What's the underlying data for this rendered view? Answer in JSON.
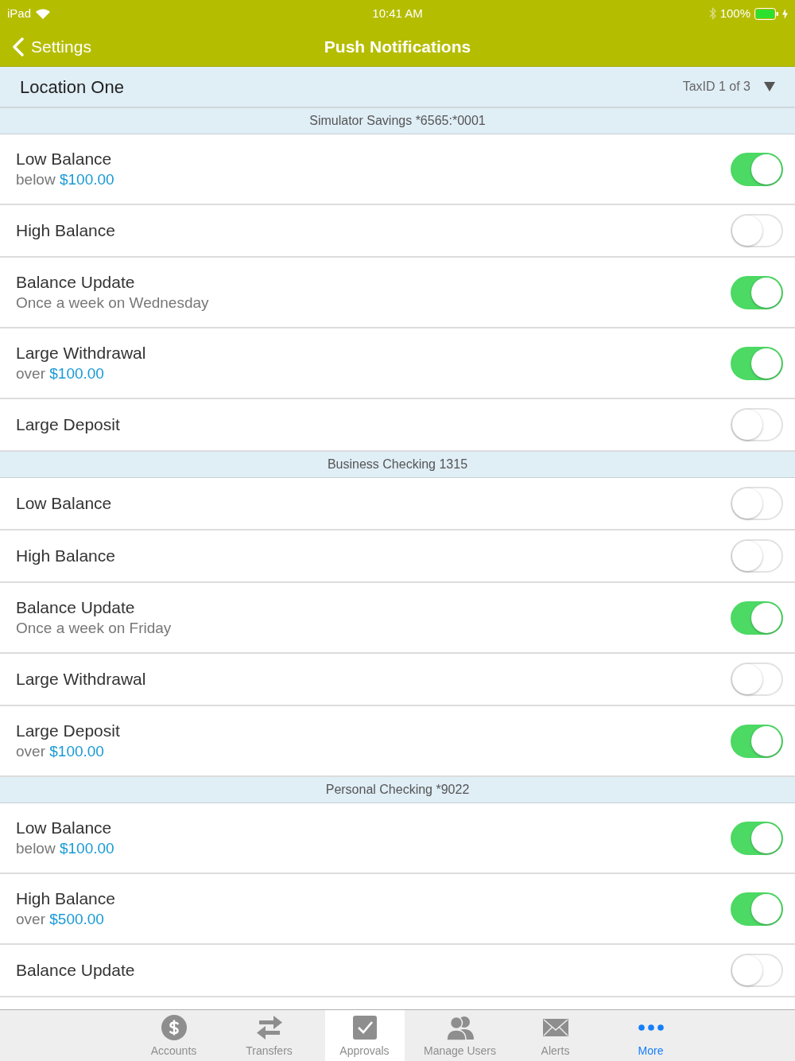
{
  "status_bar": {
    "device": "iPad",
    "time": "10:41 AM",
    "battery": "100%"
  },
  "nav_bar": {
    "back": "Settings",
    "title": "Push Notifications"
  },
  "location": {
    "name": "Location One",
    "tax_id": "TaxID 1 of 3"
  },
  "sections": [
    {
      "title": "Simulator Savings *6565:*0001",
      "rows": [
        {
          "title": "Low Balance",
          "detail": "below",
          "amount": "$100.00",
          "on": true
        },
        {
          "title": "High Balance",
          "on": false
        },
        {
          "title": "Balance Update",
          "detail": "Once a week on Wednesday",
          "on": true
        },
        {
          "title": "Large Withdrawal",
          "detail": "over",
          "amount": "$100.00",
          "on": true
        },
        {
          "title": "Large Deposit",
          "on": false
        }
      ]
    },
    {
      "title": "Business Checking 1315",
      "rows": [
        {
          "title": "Low Balance",
          "on": false
        },
        {
          "title": "High Balance",
          "on": false
        },
        {
          "title": "Balance Update",
          "detail": "Once a week on Friday",
          "on": true
        },
        {
          "title": "Large Withdrawal",
          "on": false
        },
        {
          "title": "Large Deposit",
          "detail": "over",
          "amount": "$100.00",
          "on": true
        }
      ]
    },
    {
      "title": "Personal Checking *9022",
      "rows": [
        {
          "title": "Low Balance",
          "detail": "below",
          "amount": "$100.00",
          "on": true
        },
        {
          "title": "High Balance",
          "detail": "over",
          "amount": "$500.00",
          "on": true
        },
        {
          "title": "Balance Update",
          "on": false
        }
      ]
    }
  ],
  "tabs": [
    {
      "label": "Accounts",
      "kind": "dollar",
      "selected": false,
      "highlighted": false
    },
    {
      "label": "Transfers",
      "kind": "arrows",
      "selected": false,
      "highlighted": false
    },
    {
      "label": "Approvals",
      "kind": "check",
      "selected": false,
      "highlighted": true
    },
    {
      "label": "Manage Users",
      "kind": "people",
      "selected": false,
      "highlighted": false
    },
    {
      "label": "Alerts",
      "kind": "envelope",
      "selected": false,
      "highlighted": false
    },
    {
      "label": "More",
      "kind": "dots",
      "selected": true,
      "highlighted": false
    }
  ]
}
